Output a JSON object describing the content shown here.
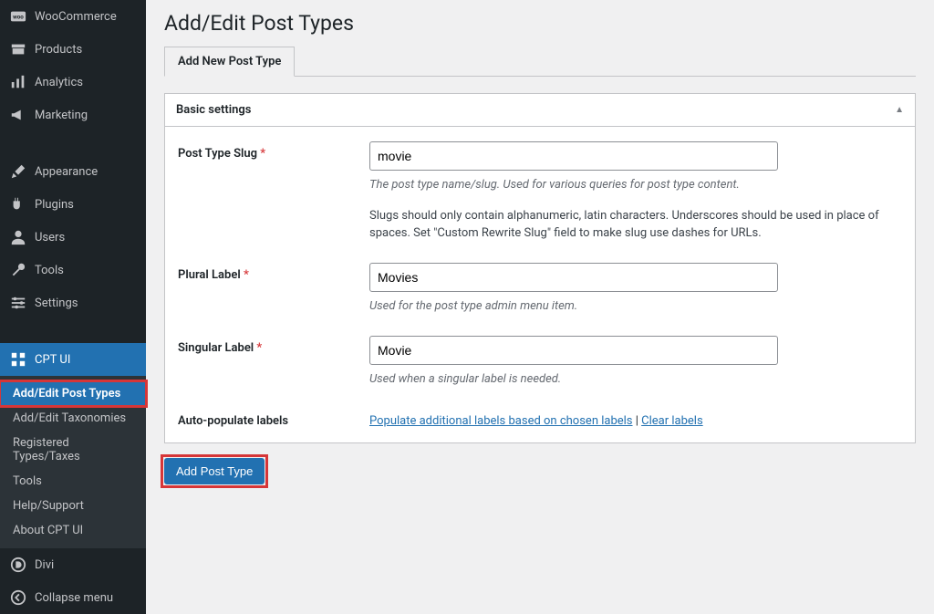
{
  "sidebar": {
    "items": [
      {
        "label": "WooCommerce",
        "icon": "woo"
      },
      {
        "label": "Products",
        "icon": "products"
      },
      {
        "label": "Analytics",
        "icon": "analytics"
      },
      {
        "label": "Marketing",
        "icon": "marketing"
      },
      {
        "label": "Appearance",
        "icon": "appearance"
      },
      {
        "label": "Plugins",
        "icon": "plugins"
      },
      {
        "label": "Users",
        "icon": "users"
      },
      {
        "label": "Tools",
        "icon": "tools"
      },
      {
        "label": "Settings",
        "icon": "settings"
      },
      {
        "label": "CPT UI",
        "icon": "cptui"
      },
      {
        "label": "Divi",
        "icon": "divi"
      },
      {
        "label": "Collapse menu",
        "icon": "collapse"
      }
    ],
    "cptui_sub": [
      {
        "label": "Add/Edit Post Types",
        "active": true
      },
      {
        "label": "Add/Edit Taxonomies"
      },
      {
        "label": "Registered Types/Taxes"
      },
      {
        "label": "Tools"
      },
      {
        "label": "Help/Support"
      },
      {
        "label": "About CPT UI"
      }
    ]
  },
  "page_title": "Add/Edit Post Types",
  "tab_label": "Add New Post Type",
  "panel_title": "Basic settings",
  "fields": {
    "slug": {
      "label": "Post Type Slug",
      "value": "movie",
      "help1": "The post type name/slug. Used for various queries for post type content.",
      "help2": "Slugs should only contain alphanumeric, latin characters. Underscores should be used in place of spaces. Set \"Custom Rewrite Slug\" field to make slug use dashes for URLs."
    },
    "plural": {
      "label": "Plural Label",
      "value": "Movies",
      "help": "Used for the post type admin menu item."
    },
    "singular": {
      "label": "Singular Label",
      "value": "Movie",
      "help": "Used when a singular label is needed."
    },
    "autopop": {
      "label": "Auto-populate labels",
      "link1": "Populate additional labels based on chosen labels",
      "sep": " | ",
      "link2": "Clear labels"
    }
  },
  "submit_label": "Add Post Type"
}
